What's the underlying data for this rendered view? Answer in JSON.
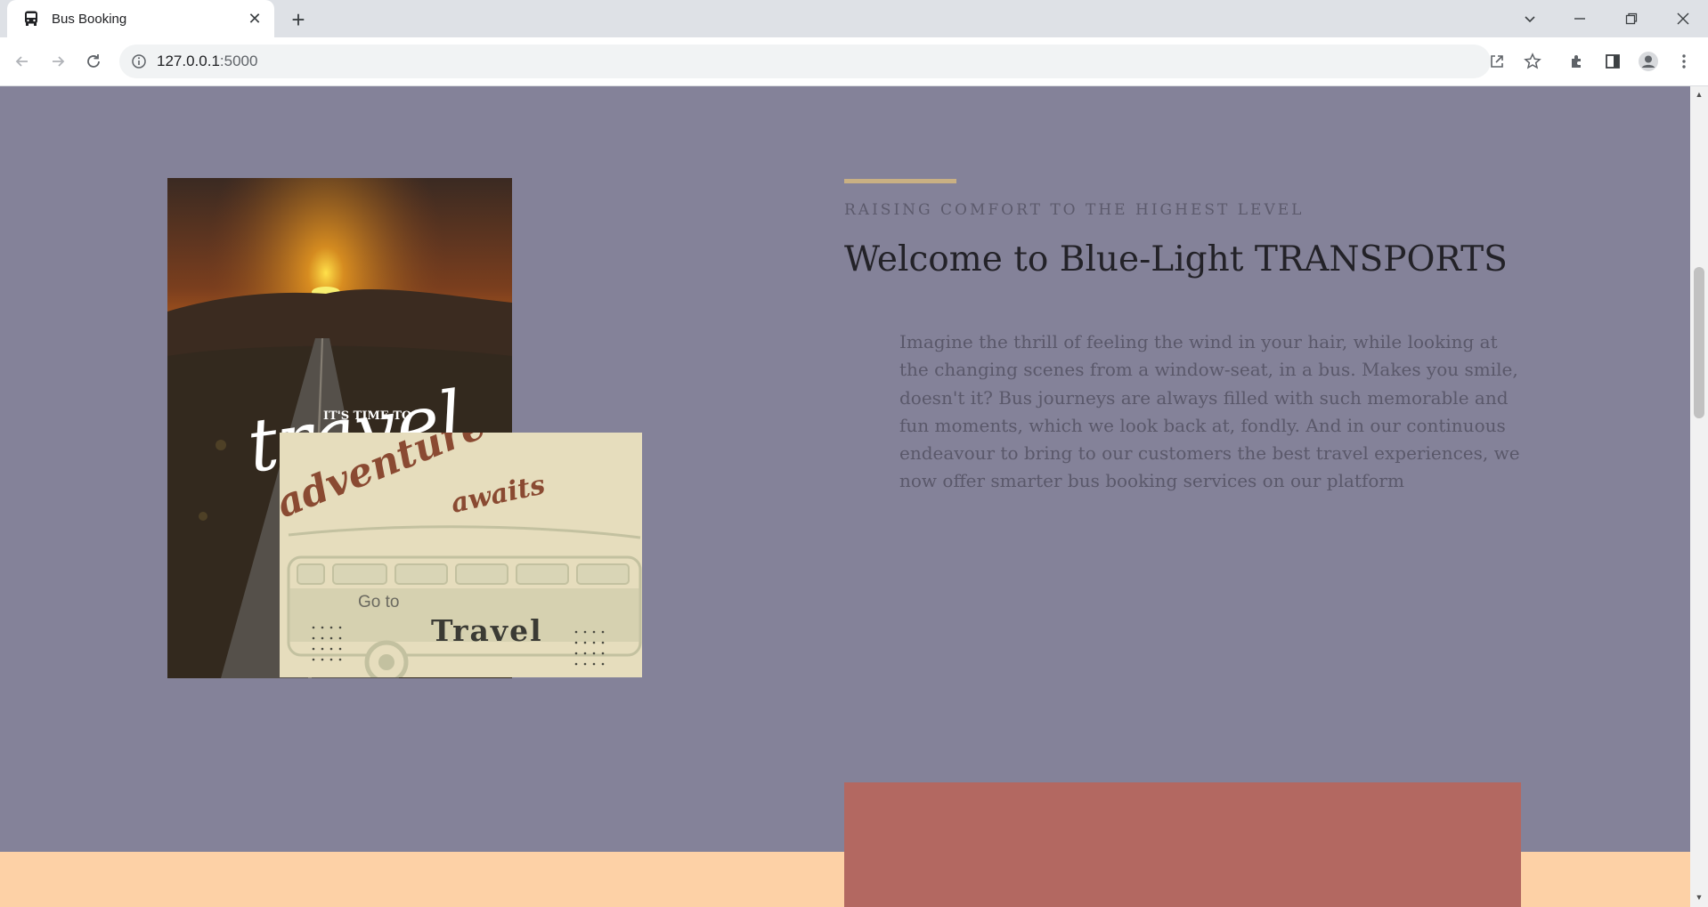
{
  "browser": {
    "tab_title": "Bus Booking",
    "tab_close": "✕",
    "new_tab": "+",
    "url_host": "127.0.0.1",
    "url_port": ":5000"
  },
  "hero": {
    "eyebrow": "RAISING COMFORT TO THE HIGHEST LEVEL",
    "headline": "Welcome to Blue-Light TRANSPORTS",
    "body": "Imagine the thrill of feeling the wind in your hair, while looking at the changing scenes from a window-seat, in a bus. Makes you smile, doesn't it? Bus journeys are always filled with such memorable and fun moments, which we look back at, fondly. And in our continuous endeavour to bring to our customers the best travel experiences, we now offer smarter bus booking services on our platform"
  },
  "images": {
    "poster_small": "IT'S TIME TO",
    "poster_big": "travel",
    "card_script_1": "adventure",
    "card_script_2": "awaits",
    "card_goto": "Go to",
    "card_travel": "Travel"
  },
  "colors": {
    "page_bg": "#848299",
    "accent": "#c9b083",
    "peach": "#fdd1a6",
    "brick": "#b36861"
  }
}
